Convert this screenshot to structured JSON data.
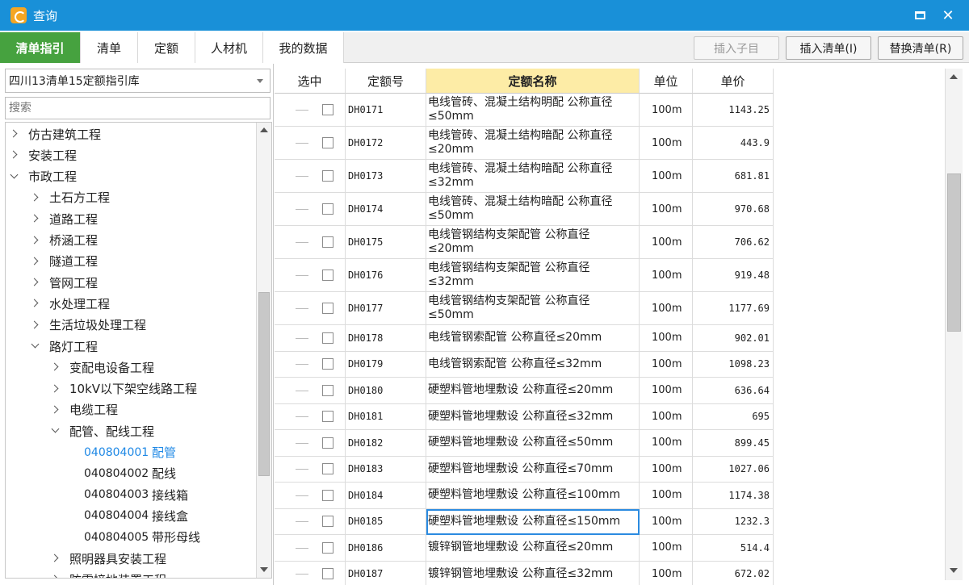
{
  "window": {
    "title": "查询"
  },
  "tabs": [
    {
      "label": "清单指引",
      "active": true
    },
    {
      "label": "清单"
    },
    {
      "label": "定额"
    },
    {
      "label": "人材机"
    },
    {
      "label": "我的数据"
    }
  ],
  "toolbar": {
    "insert_child": "插入子目",
    "insert_list": "插入清单(I)",
    "replace_list": "替换清单(R)"
  },
  "left": {
    "library": "四川13清单15定额指引库",
    "search_placeholder": "搜索",
    "tree": [
      {
        "label": "仿古建筑工程",
        "level": 0,
        "state": "collapsed"
      },
      {
        "label": "安装工程",
        "level": 0,
        "state": "collapsed"
      },
      {
        "label": "市政工程",
        "level": 0,
        "state": "expanded"
      },
      {
        "label": "土石方工程",
        "level": 1,
        "state": "collapsed"
      },
      {
        "label": "道路工程",
        "level": 1,
        "state": "collapsed"
      },
      {
        "label": "桥涵工程",
        "level": 1,
        "state": "collapsed"
      },
      {
        "label": "隧道工程",
        "level": 1,
        "state": "collapsed"
      },
      {
        "label": "管网工程",
        "level": 1,
        "state": "collapsed"
      },
      {
        "label": "水处理工程",
        "level": 1,
        "state": "collapsed"
      },
      {
        "label": "生活垃圾处理工程",
        "level": 1,
        "state": "collapsed"
      },
      {
        "label": "路灯工程",
        "level": 1,
        "state": "expanded"
      },
      {
        "label": "变配电设备工程",
        "level": 2,
        "state": "collapsed"
      },
      {
        "label": "10kV以下架空线路工程",
        "level": 2,
        "state": "collapsed"
      },
      {
        "label": "电缆工程",
        "level": 2,
        "state": "collapsed"
      },
      {
        "label": "配管、配线工程",
        "level": 2,
        "state": "expanded"
      },
      {
        "code": "040804001",
        "label": "配管",
        "level": 3,
        "state": "leaf",
        "selected": true
      },
      {
        "code": "040804002",
        "label": "配线",
        "level": 3,
        "state": "leaf"
      },
      {
        "code": "040804003",
        "label": "接线箱",
        "level": 3,
        "state": "leaf"
      },
      {
        "code": "040804004",
        "label": "接线盒",
        "level": 3,
        "state": "leaf"
      },
      {
        "code": "040804005",
        "label": "带形母线",
        "level": 3,
        "state": "leaf"
      },
      {
        "label": "照明器具安装工程",
        "level": 2,
        "state": "collapsed"
      },
      {
        "label": "防雷接地装置工程",
        "level": 2,
        "state": "collapsed"
      }
    ]
  },
  "grid": {
    "headers": {
      "select": "选中",
      "code": "定额号",
      "name": "定额名称",
      "unit": "单位",
      "price": "单价"
    },
    "rows": [
      {
        "code": "DH0171",
        "name": [
          "电线管砖、混凝土结构明配 公称直径",
          "≤50mm"
        ],
        "unit": "100m",
        "price": "1143.25"
      },
      {
        "code": "DH0172",
        "name": [
          "电线管砖、混凝土结构暗配 公称直径",
          "≤20mm"
        ],
        "unit": "100m",
        "price": "443.9"
      },
      {
        "code": "DH0173",
        "name": [
          "电线管砖、混凝土结构暗配 公称直径",
          "≤32mm"
        ],
        "unit": "100m",
        "price": "681.81"
      },
      {
        "code": "DH0174",
        "name": [
          "电线管砖、混凝土结构暗配 公称直径",
          "≤50mm"
        ],
        "unit": "100m",
        "price": "970.68"
      },
      {
        "code": "DH0175",
        "name": [
          "电线管钢结构支架配管 公称直径",
          "≤20mm"
        ],
        "unit": "100m",
        "price": "706.62"
      },
      {
        "code": "DH0176",
        "name": [
          "电线管钢结构支架配管 公称直径",
          "≤32mm"
        ],
        "unit": "100m",
        "price": "919.48"
      },
      {
        "code": "DH0177",
        "name": [
          "电线管钢结构支架配管 公称直径",
          "≤50mm"
        ],
        "unit": "100m",
        "price": "1177.69"
      },
      {
        "code": "DH0178",
        "name": [
          "电线管钢索配管 公称直径≤20mm"
        ],
        "unit": "100m",
        "price": "902.01"
      },
      {
        "code": "DH0179",
        "name": [
          "电线管钢索配管 公称直径≤32mm"
        ],
        "unit": "100m",
        "price": "1098.23"
      },
      {
        "code": "DH0180",
        "name": [
          "硬塑料管地埋敷设 公称直径≤20mm"
        ],
        "unit": "100m",
        "price": "636.64"
      },
      {
        "code": "DH0181",
        "name": [
          "硬塑料管地埋敷设 公称直径≤32mm"
        ],
        "unit": "100m",
        "price": "695"
      },
      {
        "code": "DH0182",
        "name": [
          "硬塑料管地埋敷设 公称直径≤50mm"
        ],
        "unit": "100m",
        "price": "899.45"
      },
      {
        "code": "DH0183",
        "name": [
          "硬塑料管地埋敷设 公称直径≤70mm"
        ],
        "unit": "100m",
        "price": "1027.06"
      },
      {
        "code": "DH0184",
        "name": [
          "硬塑料管地埋敷设 公称直径≤100mm"
        ],
        "unit": "100m",
        "price": "1174.38"
      },
      {
        "code": "DH0185",
        "name": [
          "硬塑料管地埋敷设 公称直径≤150mm"
        ],
        "unit": "100m",
        "price": "1232.3",
        "focused": true
      },
      {
        "code": "DH0186",
        "name": [
          "镀锌钢管地埋敷设 公称直径≤20mm"
        ],
        "unit": "100m",
        "price": "514.4"
      },
      {
        "code": "DH0187",
        "name": [
          "镀锌钢管地埋敷设 公称直径≤32mm"
        ],
        "unit": "100m",
        "price": "672.02"
      }
    ]
  },
  "colors": {
    "titlebar": "#1990d8",
    "active_tab": "#46a23f",
    "header_highlight": "#fdeca6",
    "selected_text": "#1e88e5"
  }
}
